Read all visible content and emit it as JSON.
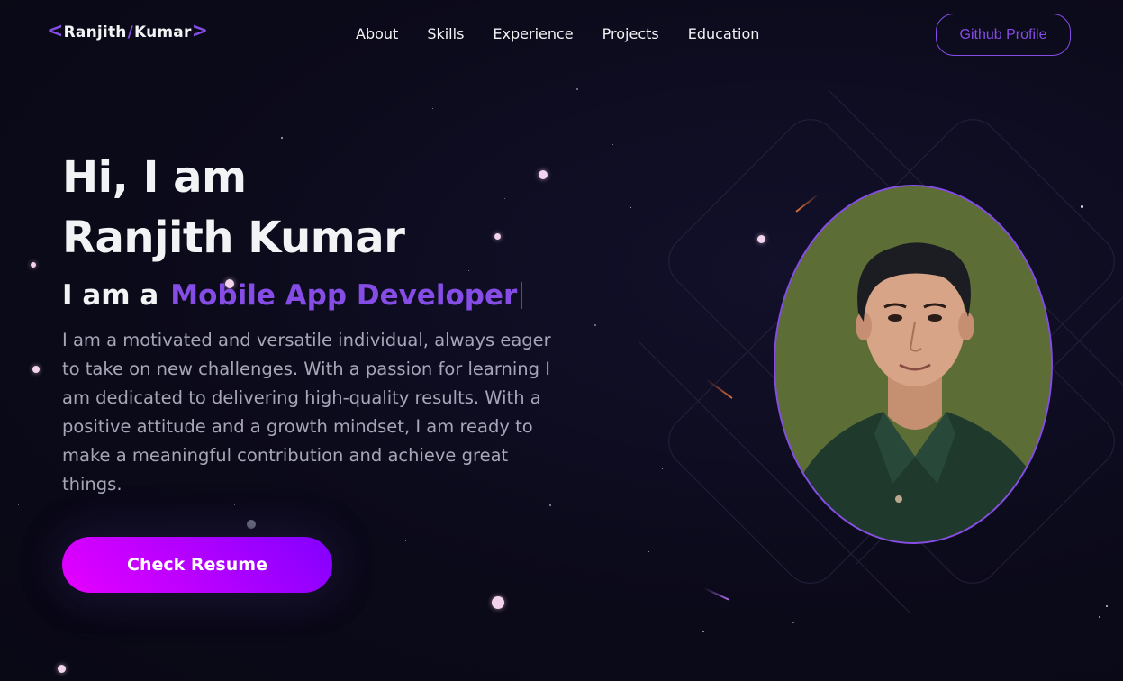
{
  "nav": {
    "logo": {
      "left": "<",
      "first": "Ranjith",
      "slash": "/",
      "last": "Kumar",
      "right": ">"
    },
    "links": [
      "About",
      "Skills",
      "Experience",
      "Projects",
      "Education"
    ],
    "github_label": "Github Profile"
  },
  "hero": {
    "title_line1": "Hi, I am",
    "title_line2": "Ranjith Kumar",
    "subtitle_prefix": "I am a",
    "subtitle_role": "Mobile App Developer",
    "description": "I am a motivated and versatile individual, always eager to take on new challenges. With a passion for learning I am dedicated to delivering high-quality results. With a positive attitude and a growth mindset, I am ready to make a meaningful contribution and achieve great things.",
    "resume_label": "Check Resume"
  },
  "colors": {
    "accent": "#854ce6",
    "background": "#0d0b1c",
    "text_primary": "#f2f3f4",
    "text_secondary": "#a6a6b7",
    "button_gradient_start": "#e600ff",
    "button_gradient_end": "#8200ff"
  },
  "icons": {
    "logo_brackets": "angle-brackets-icon",
    "profile": "profile-photo"
  }
}
